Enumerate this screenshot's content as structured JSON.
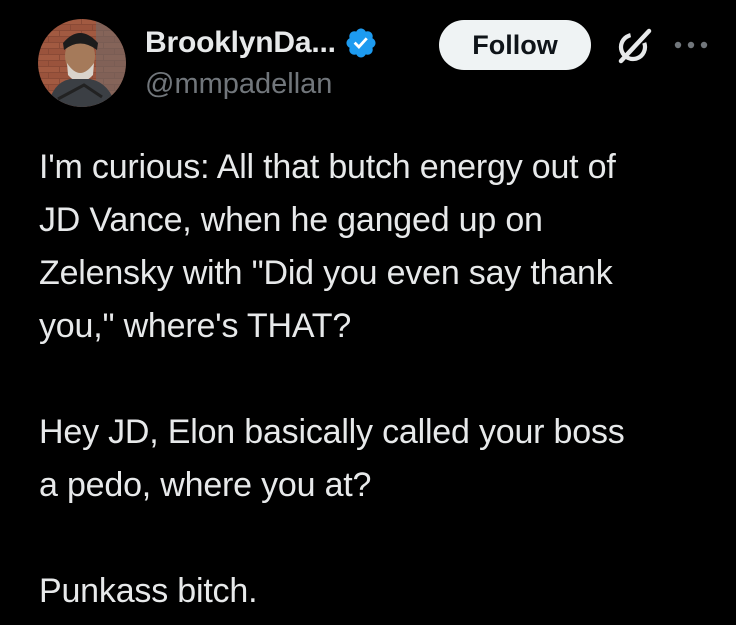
{
  "author": {
    "display_name": "BrooklynDa...",
    "handle": "@mmpadellan",
    "verified": true
  },
  "actions": {
    "follow_label": "Follow"
  },
  "icons": {
    "verified": "verified-badge-icon",
    "grok": "grok-icon",
    "more": "more-icon"
  },
  "colors": {
    "background": "#000000",
    "text": "#e7e9ea",
    "secondary_text": "#71767b",
    "verified_blue": "#1d9bf0",
    "follow_bg": "#eff3f4"
  },
  "post": {
    "paragraphs": [
      [
        "I'm curious: All that butch energy out of",
        "JD Vance, when he ganged up on",
        "Zelensky with \"Did you even say thank",
        "you,\" where's THAT?"
      ],
      [
        "Hey JD, Elon basically called your boss",
        "a pedo, where you at?"
      ],
      [
        "Punkass bitch."
      ]
    ]
  }
}
